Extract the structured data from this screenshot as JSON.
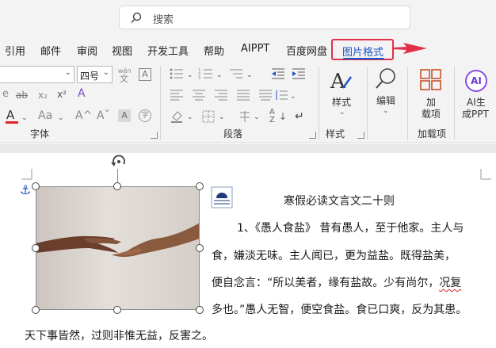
{
  "search": {
    "placeholder": "搜索"
  },
  "tabs": [
    "引用",
    "邮件",
    "审阅",
    "视图",
    "开发工具",
    "帮助",
    "AIPPT",
    "百度网盘"
  ],
  "active_tab": "图片格式",
  "ribbon": {
    "font": {
      "size_value": "四号",
      "size_btn_label": "wén",
      "group_label": "字体"
    },
    "paragraph": {
      "group_label": "段落"
    },
    "styles": {
      "button_label": "样式",
      "group_label": "样式"
    },
    "editing": {
      "button_label": "编辑"
    },
    "addins": {
      "button_label_1": "加",
      "button_label_2": "载项",
      "group_label": "加载项"
    },
    "ai": {
      "button_label_1": "AI生",
      "button_label_2": "成PPT",
      "badge": "AI"
    }
  },
  "document": {
    "title": "寒假必读文言文二十则",
    "lines": [
      "1、《愚人食盐》 昔有愚人，至于他家。主人与",
      "食，嫌淡无味。主人闻已，更为益盐。既得盐美，",
      "便自念言：“所以美者，缘有盐故。少有尚尔，",
      "多也。”愚人无智，便空食盐。食已口爽，反为其患。",
      "天下事皆然，过则非惟无益，反害之。"
    ],
    "squiggle_word": "况复"
  }
}
